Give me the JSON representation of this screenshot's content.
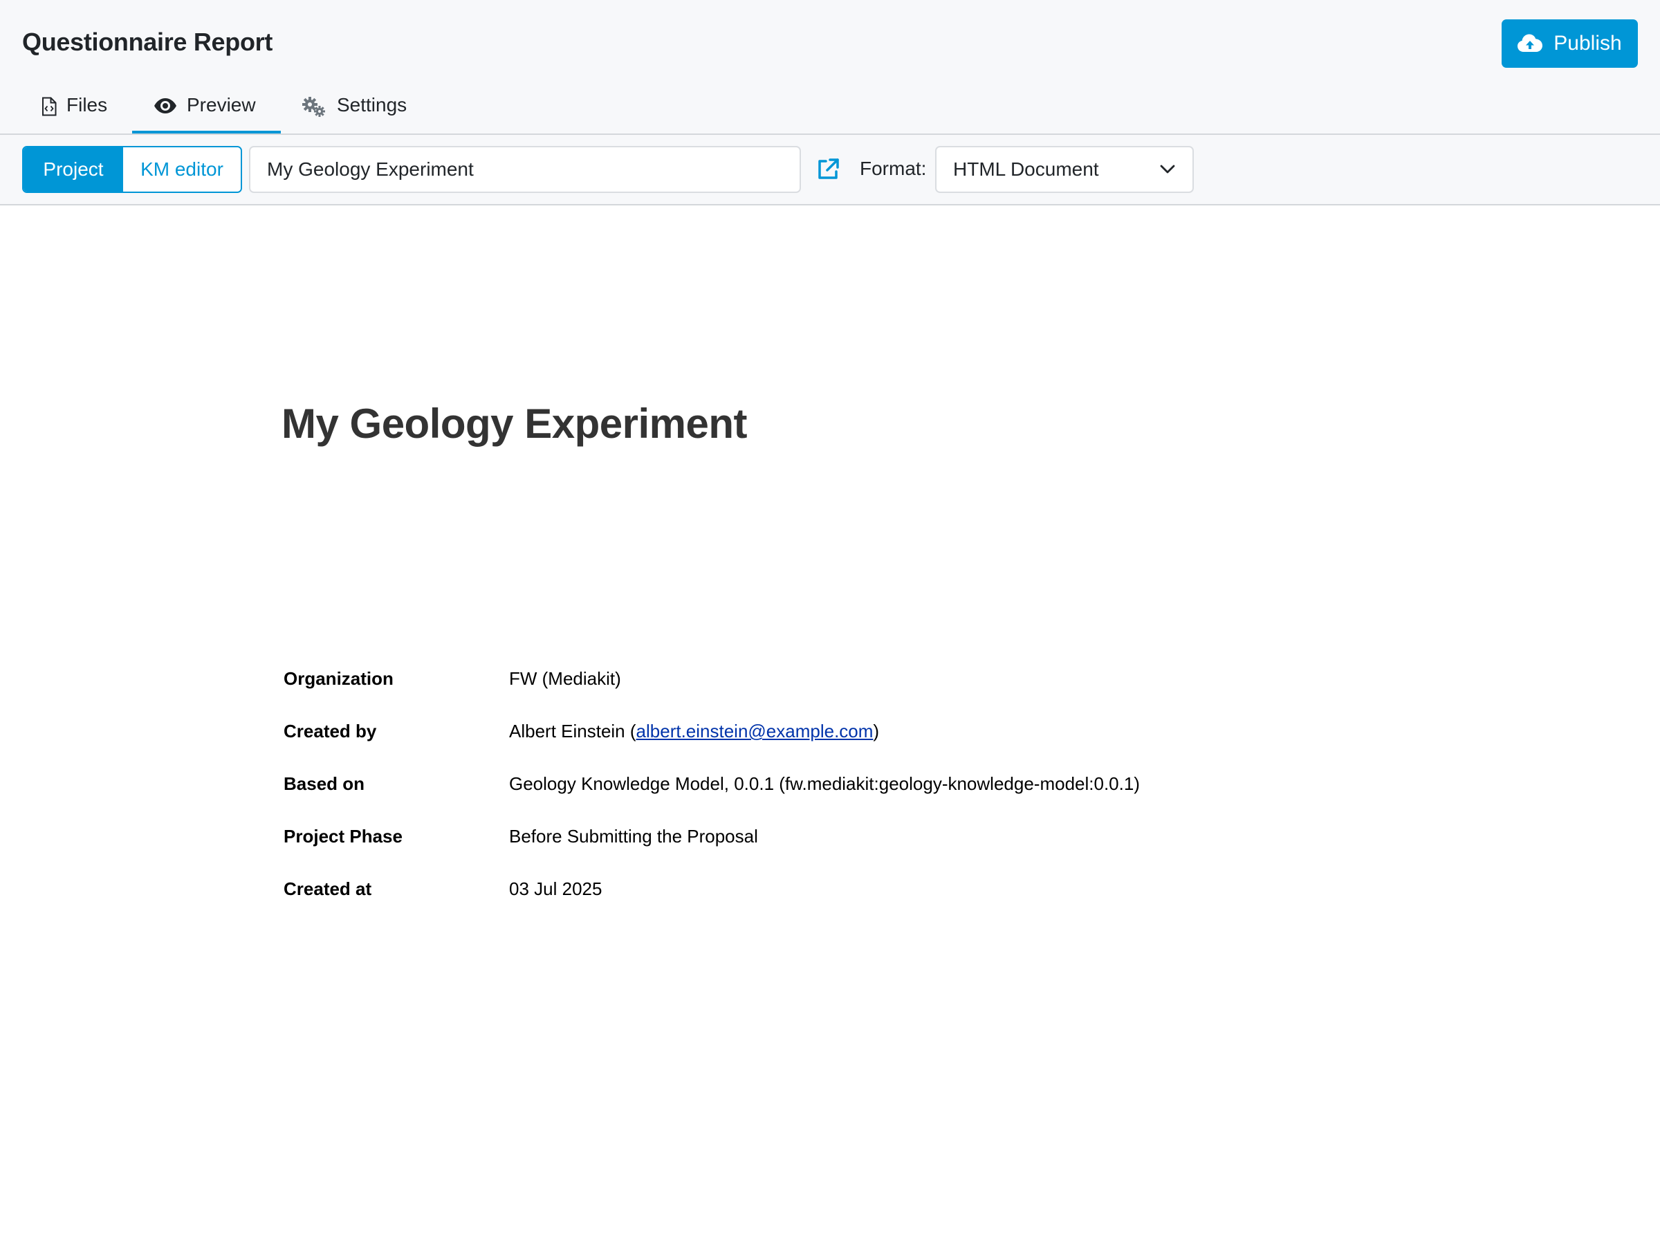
{
  "header": {
    "title": "Questionnaire Report",
    "publish_label": "Publish"
  },
  "tabs": [
    {
      "label": "Files",
      "icon": "file-code-icon"
    },
    {
      "label": "Preview",
      "icon": "eye-icon",
      "active": true
    },
    {
      "label": "Settings",
      "icon": "gears-icon"
    }
  ],
  "toolbar": {
    "mode_options": [
      {
        "label": "Project",
        "selected": true
      },
      {
        "label": "KM editor",
        "selected": false
      }
    ],
    "project_name": "My Geology Experiment",
    "format_label": "Format:",
    "format_value": "HTML Document"
  },
  "document": {
    "title": "My Geology Experiment",
    "meta": [
      {
        "label": "Organization",
        "value": "FW (Mediakit)"
      },
      {
        "label": "Created by",
        "value_prefix": "Albert Einstein (",
        "email": "albert.einstein@example.com",
        "value_suffix": ")"
      },
      {
        "label": "Based on",
        "value": "Geology Knowledge Model, 0.0.1 (fw.mediakit:geology-knowledge-model:0.0.1)"
      },
      {
        "label": "Project Phase",
        "value": "Before Submitting the Proposal"
      },
      {
        "label": "Created at",
        "value": "03 Jul 2025"
      }
    ]
  },
  "colors": {
    "accent": "#0096d6",
    "header_bg": "#f7f8fa",
    "link": "#0033aa"
  }
}
